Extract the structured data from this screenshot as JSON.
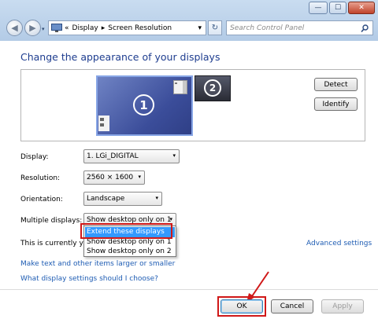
{
  "window": {
    "minimize_glyph": "—",
    "maximize_glyph": "☐",
    "close_glyph": "✕"
  },
  "nav": {
    "back_glyph": "◀",
    "forward_glyph": "▶",
    "breadcrumb_sep": "«",
    "breadcrumb": [
      "Display",
      "Screen Resolution"
    ],
    "crumb_arrow": "▸",
    "dropdown_glyph": "▾",
    "refresh_glyph": "↻",
    "search_placeholder": "Search Control Panel"
  },
  "page": {
    "heading": "Change the appearance of your displays"
  },
  "monitors": {
    "primary_number": "1",
    "secondary_number": "2"
  },
  "buttons": {
    "detect": "Detect",
    "identify": "Identify",
    "ok": "OK",
    "cancel": "Cancel",
    "apply": "Apply"
  },
  "settings": {
    "display_label": "Display:",
    "display_value": "1. LGi_DIGITAL",
    "resolution_label": "Resolution:",
    "resolution_value": "2560 × 1600",
    "orientation_label": "Orientation:",
    "orientation_value": "Landscape",
    "multiple_label": "Multiple displays:",
    "multiple_value": "Show desktop only on 1",
    "current_text": "This is currently yo"
  },
  "dropdown_menu": {
    "options": [
      "Extend these displays",
      "Show desktop only on 1",
      "Show desktop only on 2"
    ],
    "highlighted_index": 0
  },
  "links": {
    "advanced": "Advanced settings",
    "text_size": "Make text and other items larger or smaller",
    "which_settings": "What display settings should I choose?"
  },
  "colors": {
    "highlight": "#d01818",
    "link": "#1e5cb3",
    "heading": "#1e3d8f",
    "menu_highlight": "#3399ff"
  }
}
